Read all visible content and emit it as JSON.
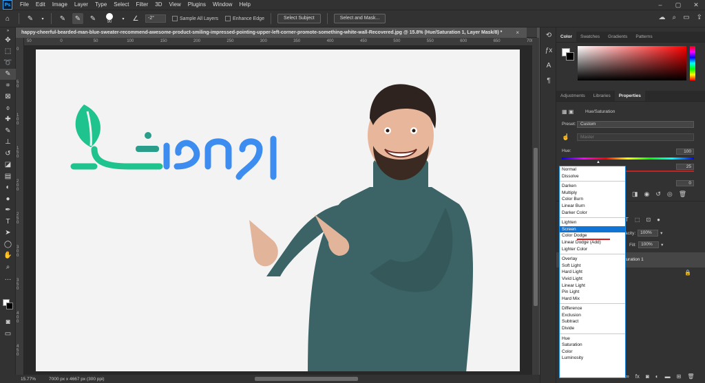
{
  "app": {
    "logo": "Ps"
  },
  "menubar": {
    "items": [
      "File",
      "Edit",
      "Image",
      "Layer",
      "Type",
      "Select",
      "Filter",
      "3D",
      "View",
      "Plugins",
      "Window",
      "Help"
    ]
  },
  "options_bar": {
    "brush_size": "90",
    "angle_value": "-2°",
    "sample_all_layers": "Sample All Layers",
    "enhance_edge": "Enhance Edge",
    "select_subject": "Select Subject",
    "select_and_mask": "Select and Mask..."
  },
  "document": {
    "tab_title": "happy-cheerful-bearded-man-blue-sweater-recommend-awesome-product-smiling-impressed-pointing-upper-left-corner-promote-something-white-wall-Recovered.jpg @ 15.8% (Hue/Saturation 1, Layer Mask/8) *",
    "close": "×"
  },
  "ruler_h": [
    "50",
    "0",
    "50",
    "100",
    "150",
    "200",
    "250",
    "300",
    "350",
    "400",
    "450",
    "500",
    "550",
    "600",
    "650",
    "700"
  ],
  "ruler_v": [
    "0",
    "5 0",
    "1 0 0",
    "1 5 0",
    "2 0 0",
    "2 5 0",
    "3 0 0",
    "3 5 0",
    "4 0 0",
    "4 5 0"
  ],
  "status": {
    "zoom": "15.77%",
    "info": "7000 px x 4667 px (300 ppi)"
  },
  "panels": {
    "color_tabs": [
      "Color",
      "Swatches",
      "Gradients",
      "Patterns"
    ],
    "props_tabs": [
      "Adjustments",
      "Libraries",
      "Properties"
    ],
    "props_title": "Hue/Saturation",
    "preset_label": "Preset:",
    "preset_value": "Custom",
    "channel_value": "Master",
    "hue_label": "Hue:",
    "hue_value": "100",
    "saturation_value": "25",
    "lightness_value": "0",
    "opacity_label": "Opacity:",
    "opacity_short": "acity:",
    "opacity_value": "100%",
    "fill_label": "Fill:",
    "fill_value": "100%",
    "layer_name": "aturation 1"
  },
  "blend_modes": {
    "groups": [
      [
        "Normal",
        "Dissolve"
      ],
      [
        "Darken",
        "Multiply",
        "Color Burn",
        "Linear Burn",
        "Darker Color"
      ],
      [
        "Lighten",
        "Screen",
        "Color Dodge",
        "Linear Dodge (Add)",
        "Lighter Color"
      ],
      [
        "Overlay",
        "Soft Light",
        "Hard Light",
        "Vivid Light",
        "Linear Light",
        "Pin Light",
        "Hard Mix"
      ],
      [
        "Difference",
        "Exclusion",
        "Subtract",
        "Divide"
      ],
      [
        "Hue",
        "Saturation",
        "Color",
        "Luminosity"
      ]
    ],
    "selected": "Screen"
  },
  "colors": {
    "accent": "#0f74d4",
    "logo_green": "#1fc38d",
    "logo_blue": "#3d8df0",
    "sweater": "#3c6466"
  }
}
